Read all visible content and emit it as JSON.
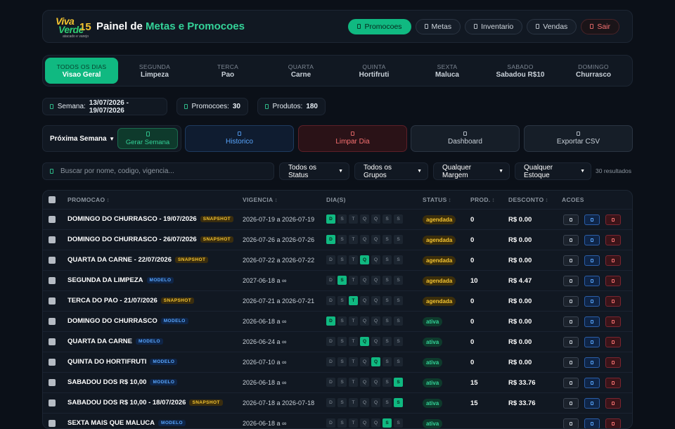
{
  "header": {
    "logo_line1": "Viva",
    "logo_line2": "Verde",
    "logo_number": "15",
    "logo_sub": "atacado e varejo",
    "title_prefix": "Painel de",
    "title_highlight": "Metas e Promocoes",
    "nav": [
      {
        "label": "Promocoes",
        "icon": "tag-icon"
      },
      {
        "label": "Metas",
        "icon": "target-icon"
      },
      {
        "label": "Inventario",
        "icon": "box-icon"
      },
      {
        "label": "Vendas",
        "icon": "chart-icon"
      },
      {
        "label": "Sair",
        "icon": "exit-icon"
      }
    ]
  },
  "days": [
    {
      "top": "TODOS OS DIAS",
      "bottom": "Visao Geral"
    },
    {
      "top": "SEGUNDA",
      "bottom": "Limpeza"
    },
    {
      "top": "TERCA",
      "bottom": "Pao"
    },
    {
      "top": "QUARTA",
      "bottom": "Carne"
    },
    {
      "top": "QUINTA",
      "bottom": "Hortifruti"
    },
    {
      "top": "SEXTA",
      "bottom": "Maluca"
    },
    {
      "top": "SABADO",
      "bottom": "Sabadou R$10"
    },
    {
      "top": "DOMINGO",
      "bottom": "Churrasco"
    }
  ],
  "stats": {
    "week_label": "Semana:",
    "week_value": "13/07/2026 - 19/07/2026",
    "promos_label": "Promocoes:",
    "promos_value": "30",
    "products_label": "Produtos:",
    "products_value": "180"
  },
  "actions": {
    "week_select": "Próxima Semana",
    "generate": "Gerar Semana",
    "history": "Historico",
    "clear": "Limpar Dia",
    "dashboard": "Dashboard",
    "export": "Exportar CSV"
  },
  "filters": {
    "search_placeholder": "Buscar por nome, codigo, vigencia...",
    "status": "Todos os Status",
    "groups": "Todos os Grupos",
    "margin": "Qualquer Margem",
    "stock": "Qualquer Estoque",
    "results": "30 resultados"
  },
  "table": {
    "headers": {
      "promo": "PROMOCAO",
      "vig": "VIGENCIA",
      "days": "DIA(S)",
      "status": "STATUS",
      "prod": "PROD.",
      "disc": "DESCONTO",
      "acts": "ACOES"
    },
    "day_letters": [
      "D",
      "S",
      "T",
      "Q",
      "Q",
      "S",
      "S"
    ],
    "rows": [
      {
        "name": "DOMINGO DO CHURRASCO - 19/07/2026",
        "tag": "SNAPSHOT",
        "vig": "2026-07-19 a 2026-07-19",
        "on": [
          0
        ],
        "status": "agendada",
        "prod": "0",
        "disc": "R$ 0.00"
      },
      {
        "name": "DOMINGO DO CHURRASCO - 26/07/2026",
        "tag": "SNAPSHOT",
        "vig": "2026-07-26 a 2026-07-26",
        "on": [
          0
        ],
        "status": "agendada",
        "prod": "0",
        "disc": "R$ 0.00"
      },
      {
        "name": "QUARTA DA CARNE - 22/07/2026",
        "tag": "SNAPSHOT",
        "vig": "2026-07-22 a 2026-07-22",
        "on": [
          3
        ],
        "status": "agendada",
        "prod": "0",
        "disc": "R$ 0.00"
      },
      {
        "name": "SEGUNDA DA LIMPEZA",
        "tag": "MODELO",
        "vig": "2027-06-18 a ∞",
        "on": [
          1
        ],
        "status": "agendada",
        "prod": "10",
        "disc": "R$ 4.47"
      },
      {
        "name": "TERCA DO PAO - 21/07/2026",
        "tag": "SNAPSHOT",
        "vig": "2026-07-21 a 2026-07-21",
        "on": [
          2
        ],
        "status": "agendada",
        "prod": "0",
        "disc": "R$ 0.00"
      },
      {
        "name": "DOMINGO DO CHURRASCO",
        "tag": "MODELO",
        "vig": "2026-06-18 a ∞",
        "on": [
          0
        ],
        "status": "ativa",
        "prod": "0",
        "disc": "R$ 0.00"
      },
      {
        "name": "QUARTA DA CARNE",
        "tag": "MODELO",
        "vig": "2026-06-24 a ∞",
        "on": [
          3
        ],
        "status": "ativa",
        "prod": "0",
        "disc": "R$ 0.00"
      },
      {
        "name": "QUINTA DO HORTIFRUTI",
        "tag": "MODELO",
        "vig": "2026-07-10 a ∞",
        "on": [
          4
        ],
        "status": "ativa",
        "prod": "0",
        "disc": "R$ 0.00"
      },
      {
        "name": "SABADOU DOS R$ 10,00",
        "tag": "MODELO",
        "vig": "2026-06-18 a ∞",
        "on": [
          6
        ],
        "status": "ativa",
        "prod": "15",
        "disc": "R$ 33.76"
      },
      {
        "name": "SABADOU DOS R$ 10,00 - 18/07/2026",
        "tag": "SNAPSHOT",
        "vig": "2026-07-18 a 2026-07-18",
        "on": [
          6
        ],
        "status": "ativa",
        "prod": "15",
        "disc": "R$ 33.76"
      },
      {
        "name": "SEXTA MAIS QUE MALUCA",
        "tag": "MODELO",
        "vig": "2026-06-18 a ∞",
        "on": [
          5
        ],
        "status": "ativa",
        "prod": "",
        "disc": ""
      }
    ]
  }
}
